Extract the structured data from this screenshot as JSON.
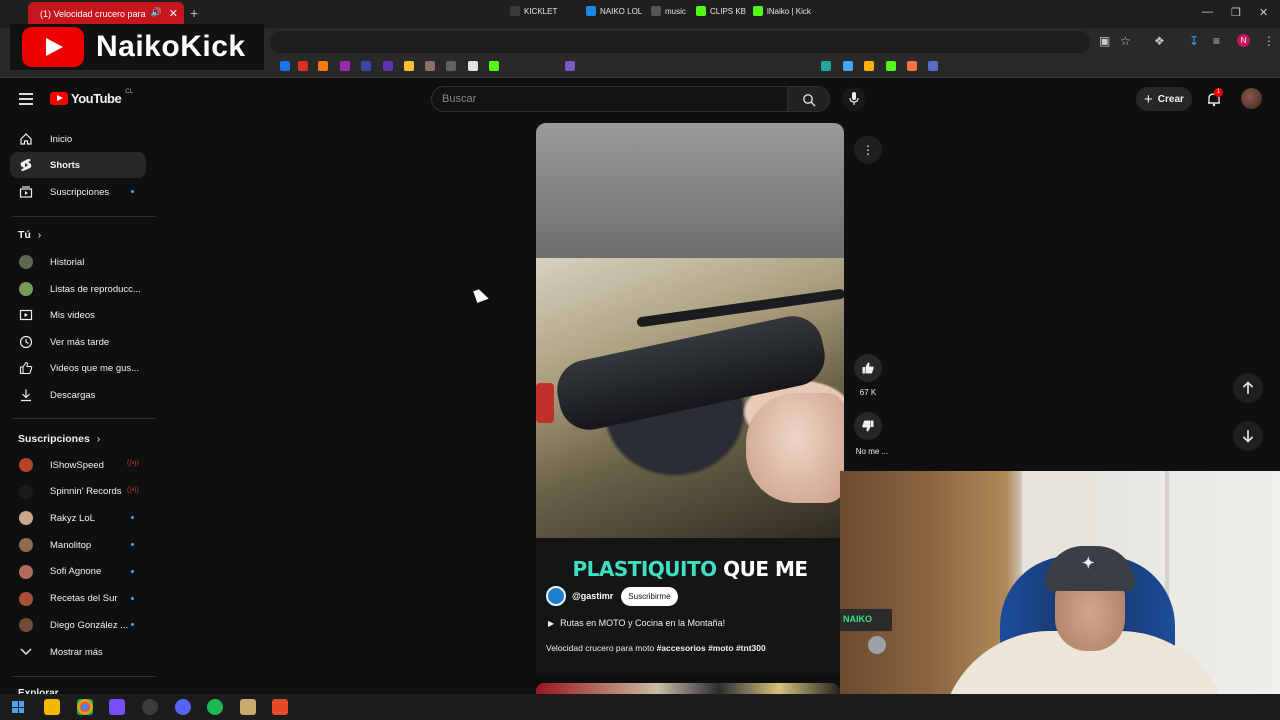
{
  "browser": {
    "tab_title": "(1) Velocidad crucero para",
    "bookmarks": [
      "KICKLET",
      "NAIKO LOL",
      "music",
      "CLIPS KB",
      "lNaiko | Kick"
    ]
  },
  "stream_overlay": {
    "name": "NaikoKick"
  },
  "youtube": {
    "logo_text": "YouTube",
    "country_code": "CL",
    "search_placeholder": "Buscar",
    "create_label": "Crear",
    "notif_count": "1"
  },
  "sidebar": {
    "main": [
      {
        "label": "Inicio"
      },
      {
        "label": "Shorts"
      },
      {
        "label": "Suscripciones"
      }
    ],
    "you_title": "Tú",
    "you": [
      {
        "label": "Historial"
      },
      {
        "label": "Listas de reproducc..."
      },
      {
        "label": "Mis videos"
      },
      {
        "label": "Ver más tarde"
      },
      {
        "label": "Videos que me gus..."
      },
      {
        "label": "Descargas"
      }
    ],
    "subs_title": "Suscripciones",
    "subs": [
      {
        "label": "IShowSpeed",
        "color": "#b4452a"
      },
      {
        "label": "Spinnin' Records",
        "color": "#1a1a1a"
      },
      {
        "label": "Rakyz LoL",
        "color": "#c9a58a"
      },
      {
        "label": "Manolitop",
        "color": "#8e6a4e"
      },
      {
        "label": "Sofi Agnone",
        "color": "#b06a5a"
      },
      {
        "label": "Recetas del Sur",
        "color": "#a8503a"
      },
      {
        "label": "Diego González ...",
        "color": "#6d4c3a"
      }
    ],
    "show_more": "Mostrar más",
    "explore_title": "Explorar"
  },
  "short": {
    "caption_highlight": "PLASTIQUITO",
    "caption_rest": "QUE ME",
    "channel_handle": "@gastimr",
    "subscribe_label": "Suscribirme",
    "playlist": "Rutas en MOTO y Cocina en la Montaña!",
    "description": "Velocidad crucero para moto",
    "hashtags": "#accesorios #moto #tnt300",
    "like_count": "67 K",
    "dislike_label": "No me ..."
  },
  "webcam": {
    "sticker_text": "NAIKO"
  },
  "colors": {
    "accent_red": "#ff0000",
    "caption_cyan": "#3ee0c5",
    "dot_blue": "#3ea6ff"
  }
}
